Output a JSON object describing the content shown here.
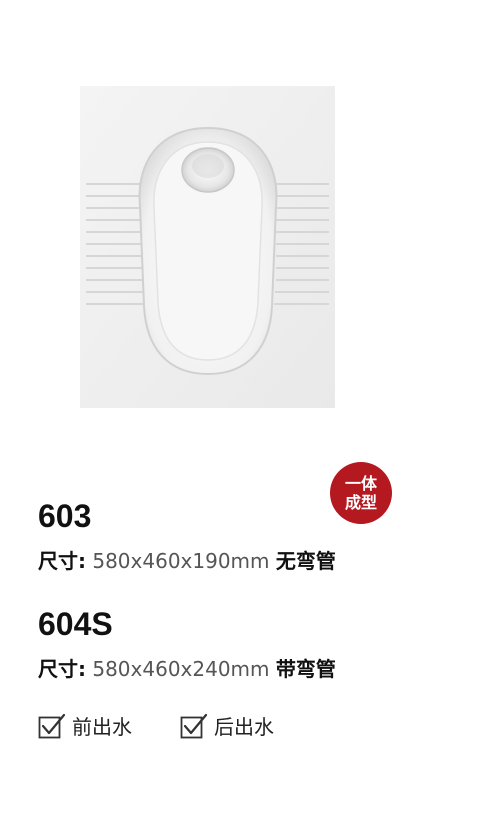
{
  "badge": {
    "line1": "一体",
    "line2": "成型",
    "color": "#b3191f"
  },
  "products": [
    {
      "model": "603",
      "spec_label": "尺寸:",
      "spec_value": " 580x460x190mm ",
      "spec_tag": "无弯管"
    },
    {
      "model": "604S",
      "spec_label": "尺寸:",
      "spec_value": " 580x460x240mm ",
      "spec_tag": "带弯管"
    }
  ],
  "options": [
    {
      "label": "前出水",
      "checked": true
    },
    {
      "label": "后出水",
      "checked": true
    }
  ]
}
